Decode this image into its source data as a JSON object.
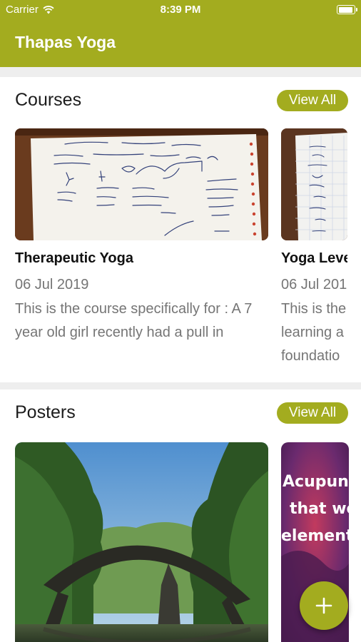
{
  "status_bar": {
    "carrier": "Carrier",
    "time": "8:39 PM",
    "wifi_icon": "wifi-icon",
    "battery_icon": "battery-icon"
  },
  "app_bar": {
    "title": "Thapas Yoga"
  },
  "courses": {
    "title": "Courses",
    "view_all": "View All",
    "items": [
      {
        "title": "Therapeutic Yoga",
        "date": "06 Jul 2019",
        "description": "This is the course specifically for : A 7 year old girl recently had a pull in"
      },
      {
        "title": "Yoga Leve",
        "date": "06 Jul 201",
        "description": "This is the learning a foundatio"
      }
    ]
  },
  "posters": {
    "title": "Posters",
    "view_all": "View All",
    "items": [
      {
        "image": "stone-arch-bridge-over-lake-in-forest"
      },
      {
        "image": "acupuncture-poster",
        "text": "Acupunc that wo elements"
      }
    ]
  },
  "fab": {
    "icon": "plus-icon"
  },
  "colors": {
    "accent": "#a3ac1f",
    "text_secondary": "#757575"
  }
}
